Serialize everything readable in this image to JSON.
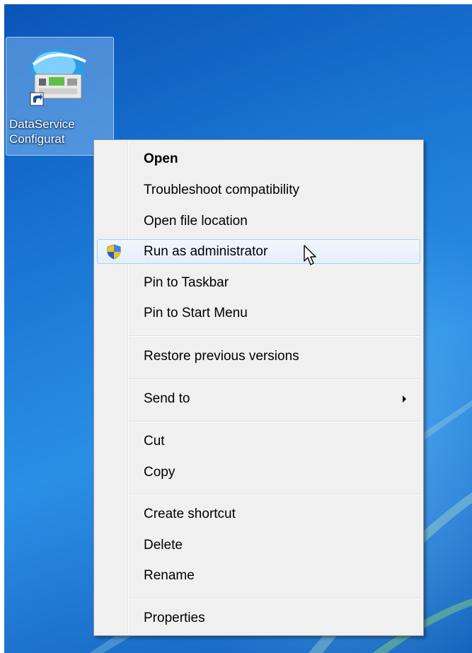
{
  "desktop": {
    "icon": {
      "label_line1": "DataService",
      "label_line2": "Configurat",
      "image": "dataservice-app-icon",
      "overlay": "shortcut-arrow-icon"
    }
  },
  "context_menu": {
    "items": [
      {
        "label": "Open",
        "bold": true
      },
      {
        "label": "Troubleshoot compatibility"
      },
      {
        "label": "Open file location"
      },
      {
        "label": "Run as administrator",
        "icon": "uac-shield-icon",
        "highlighted": true
      },
      {
        "label": "Pin to Taskbar"
      },
      {
        "label": "Pin to Start Menu"
      },
      {
        "label": "Restore previous versions"
      },
      {
        "label": "Send to",
        "submenu": true
      },
      {
        "label": "Cut"
      },
      {
        "label": "Copy"
      },
      {
        "label": "Create shortcut"
      },
      {
        "label": "Delete"
      },
      {
        "label": "Rename"
      },
      {
        "label": "Properties"
      }
    ]
  },
  "pointer": "arrow-cursor-icon",
  "colors": {
    "menu_background": "#f0f0f0",
    "hover_border": "#aecff7",
    "desktop_blue": "#1b78d6"
  }
}
